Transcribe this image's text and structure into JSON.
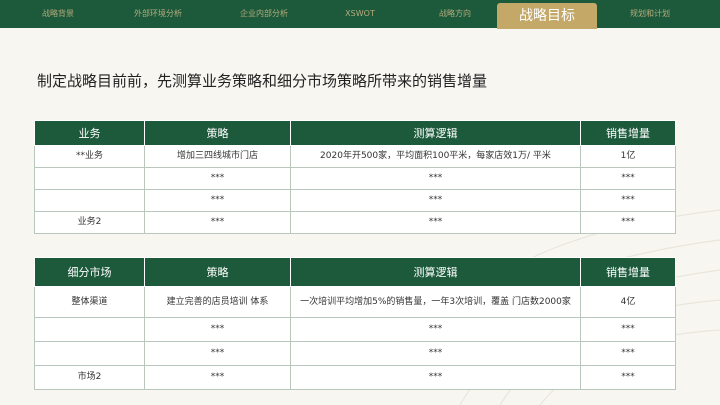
{
  "nav": {
    "items": [
      "战略背景",
      "外部环境分析",
      "企业内部分析",
      "XSWOT",
      "战略方向",
      "战略目标",
      "规划和计划"
    ],
    "active_index": 5
  },
  "page_title": "制定战略目前前，先测算业务策略和细分市场策略所带来的销售增量",
  "table1": {
    "headers": [
      "业务",
      "策略",
      "测算逻辑",
      "销售增量"
    ],
    "rows": [
      [
        "**业务",
        "增加三四线城市门店",
        "2020年开500家，平均面积100平米，每家店效1万/ 平米",
        "1亿"
      ],
      [
        "",
        "***",
        "***",
        "***"
      ],
      [
        "",
        "***",
        "***",
        "***"
      ],
      [
        "业务2",
        "***",
        "***",
        "***"
      ]
    ]
  },
  "table2": {
    "headers": [
      "细分市场",
      "策略",
      "测算逻辑",
      "销售增量"
    ],
    "rows": [
      [
        "整体渠道",
        "建立完善的店员培训 体系",
        "一次培训平均增加5%的销售量，一年3次培训，覆盖 门店数2000家",
        "4亿"
      ],
      [
        "",
        "***",
        "***",
        "***"
      ],
      [
        "",
        "***",
        "***",
        "***"
      ],
      [
        "市场2",
        "***",
        "***",
        "***"
      ]
    ]
  },
  "colors": {
    "primary_green": "#1c5a3b",
    "gold_accent": "#c3a868",
    "background": "#f7f6f1"
  }
}
